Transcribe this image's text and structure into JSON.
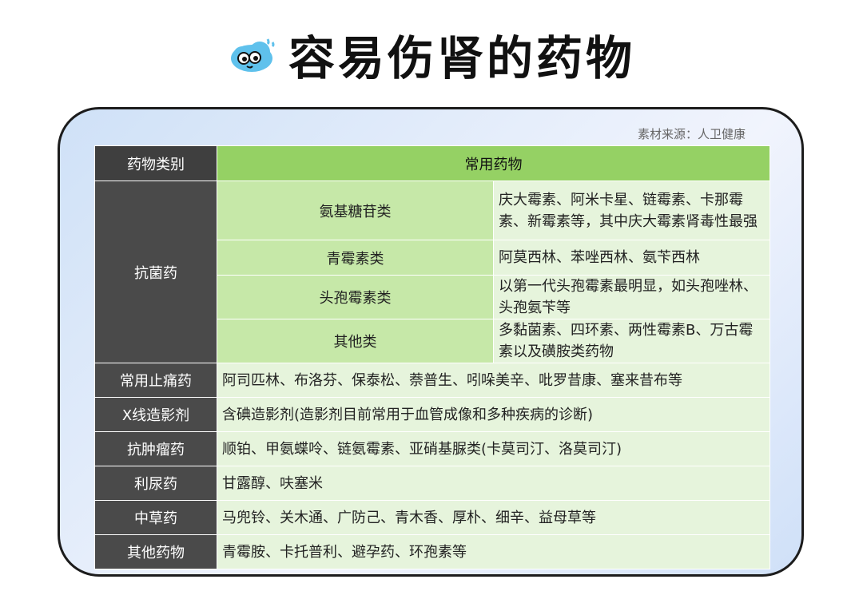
{
  "title": "容易伤肾的药物",
  "title_icon": "cute-cloud-face-icon",
  "source": "素材来源：人卫健康",
  "table": {
    "headers": [
      "药物类别",
      "常用药物"
    ],
    "antibacterial": {
      "category": "抗菌药",
      "rows": [
        {
          "sub": "氨基糖苷类",
          "value": "庆大霉素、阿米卡星、链霉素、卡那霉素、新霉素等，其中庆大霉素肾毒性最强"
        },
        {
          "sub": "青霉素类",
          "value": "阿莫西林、苯唑西林、氨苄西林"
        },
        {
          "sub": "头孢霉素类",
          "value": "以第一代头孢霉素最明显，如头孢唑林、头孢氨苄等"
        },
        {
          "sub": "其他类",
          "value": "多黏菌素、四环素、两性霉素B、万古霉素以及磺胺类药物"
        }
      ]
    },
    "rows": [
      {
        "category": "常用止痛药",
        "value": "阿司匹林、布洛芬、保泰松、萘普生、吲哚美辛、吡罗昔康、塞来昔布等"
      },
      {
        "category": "X线造影剂",
        "value": "含碘造影剂(造影剂目前常用于血管成像和多种疾病的诊断)"
      },
      {
        "category": "抗肿瘤药",
        "value": "顺铂、甲氨蝶呤、链氨霉素、亚硝基脲类(卡莫司汀、洛莫司汀)"
      },
      {
        "category": "利尿药",
        "value": "甘露醇、呋塞米"
      },
      {
        "category": "中草药",
        "value": "马兜铃、关木通、广防己、青木香、厚朴、细辛、益母草等"
      },
      {
        "category": "其他药物",
        "value": "青霉胺、卡托普利、避孕药、环孢素等"
      }
    ]
  }
}
